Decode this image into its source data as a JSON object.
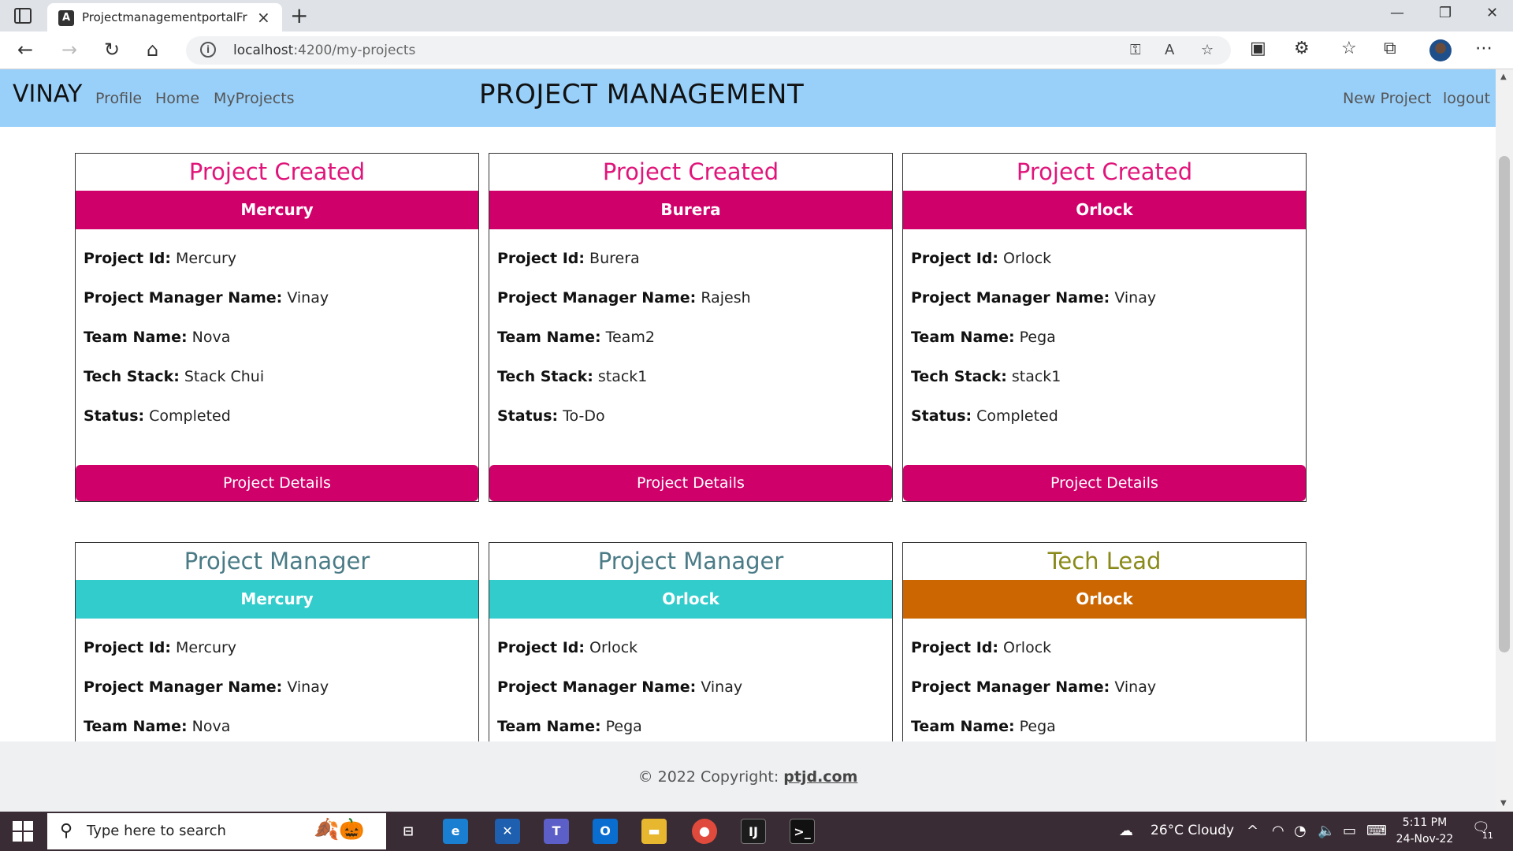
{
  "browser": {
    "tab_title": "ProjectmanagementportalFronte",
    "tab_icon": "angular-icon",
    "url_host": "localhost",
    "url_path": ":4200/my-projects"
  },
  "navbar": {
    "brand": "VINAY",
    "links": [
      "Profile",
      "Home",
      "MyProjects"
    ],
    "title": "PROJECT MANAGEMENT",
    "right_links": [
      "New Project",
      "logout"
    ]
  },
  "cards": [
    {
      "title": "Project Created",
      "name": "Mercury",
      "project_id": "Mercury",
      "manager": "Vinay",
      "team": "Nova",
      "tech_stack": "Stack Chui",
      "status": "Completed",
      "button": "Project Details",
      "title_color": "#e0157a",
      "header_color": "#d0006a"
    },
    {
      "title": "Project Created",
      "name": "Burera",
      "project_id": "Burera",
      "manager": "Rajesh",
      "team": "Team2",
      "tech_stack": "stack1",
      "status": "To-Do",
      "button": "Project Details",
      "title_color": "#e0157a",
      "header_color": "#d0006a"
    },
    {
      "title": "Project Created",
      "name": "Orlock",
      "project_id": "Orlock",
      "manager": "Vinay",
      "team": "Pega",
      "tech_stack": "stack1",
      "status": "Completed",
      "button": "Project Details",
      "title_color": "#e0157a",
      "header_color": "#d0006a"
    },
    {
      "title": "Project Manager",
      "name": "Mercury",
      "project_id": "Mercury",
      "manager": "Vinay",
      "team": "Nova",
      "title_color": "#4a7b86",
      "header_color": "#33cccc"
    },
    {
      "title": "Project Manager",
      "name": "Orlock",
      "project_id": "Orlock",
      "manager": "Vinay",
      "team": "Pega",
      "title_color": "#4a7b86",
      "header_color": "#33cccc"
    },
    {
      "title": "Tech Lead",
      "name": "Orlock",
      "project_id": "Orlock",
      "manager": "Vinay",
      "team": "Pega",
      "title_color": "#8a8a1a",
      "header_color": "#cc6600"
    }
  ],
  "labels": {
    "project_id": "Project Id:",
    "manager": "Project Manager Name:",
    "team": "Team Name:",
    "tech_stack": "Tech Stack:",
    "status": "Status:"
  },
  "footer": {
    "text": "© 2022 Copyright: ",
    "link": "ptjd.com"
  },
  "taskbar": {
    "search_placeholder": "Type here to search",
    "weather": "26°C  Cloudy",
    "time": "5:11 PM",
    "date": "24-Nov-22",
    "notification_count": "11"
  }
}
